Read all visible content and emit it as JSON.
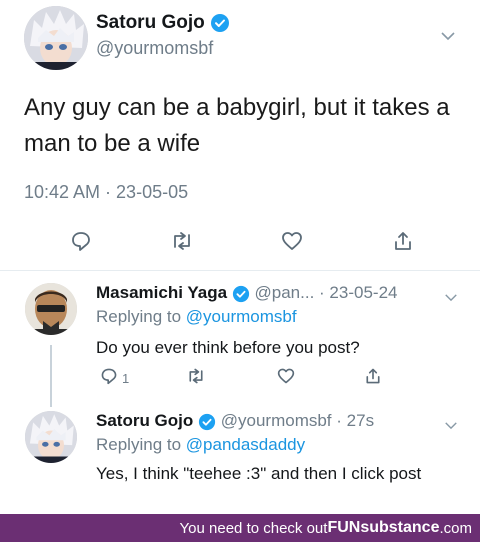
{
  "main_tweet": {
    "name": "Satoru Gojo",
    "handle": "@yourmomsbf",
    "text": "Any guy can be a babygirl, but it takes a man to be a wife",
    "time": "10:42 AM · 23-05-05"
  },
  "replies": [
    {
      "name": "Masamichi Yaga",
      "handle": "@pan...",
      "date": "· 23-05-24",
      "replying_label": "Replying to ",
      "replying_to": "@yourmomsbf",
      "text": "Do you ever think before you post?",
      "reply_count": "1"
    },
    {
      "name": "Satoru Gojo",
      "handle": "@yourmomsbf",
      "date": "· 27s",
      "replying_label": "Replying to ",
      "replying_to": "@pandasdaddy",
      "text": "Yes, I think \"teehee :3\" and then I click post"
    }
  ],
  "watermark": {
    "text": "You need to check out ",
    "brand": "FUNsubstance",
    "suffix": ".com"
  },
  "colors": {
    "verified": "#1da1f2",
    "link": "#1b95e0",
    "muted": "#6f7d89",
    "watermark_bg": "#6b2f73"
  },
  "icons": [
    "reply-icon",
    "retweet-icon",
    "like-icon",
    "share-icon",
    "verified-icon",
    "chevron-down-icon"
  ]
}
